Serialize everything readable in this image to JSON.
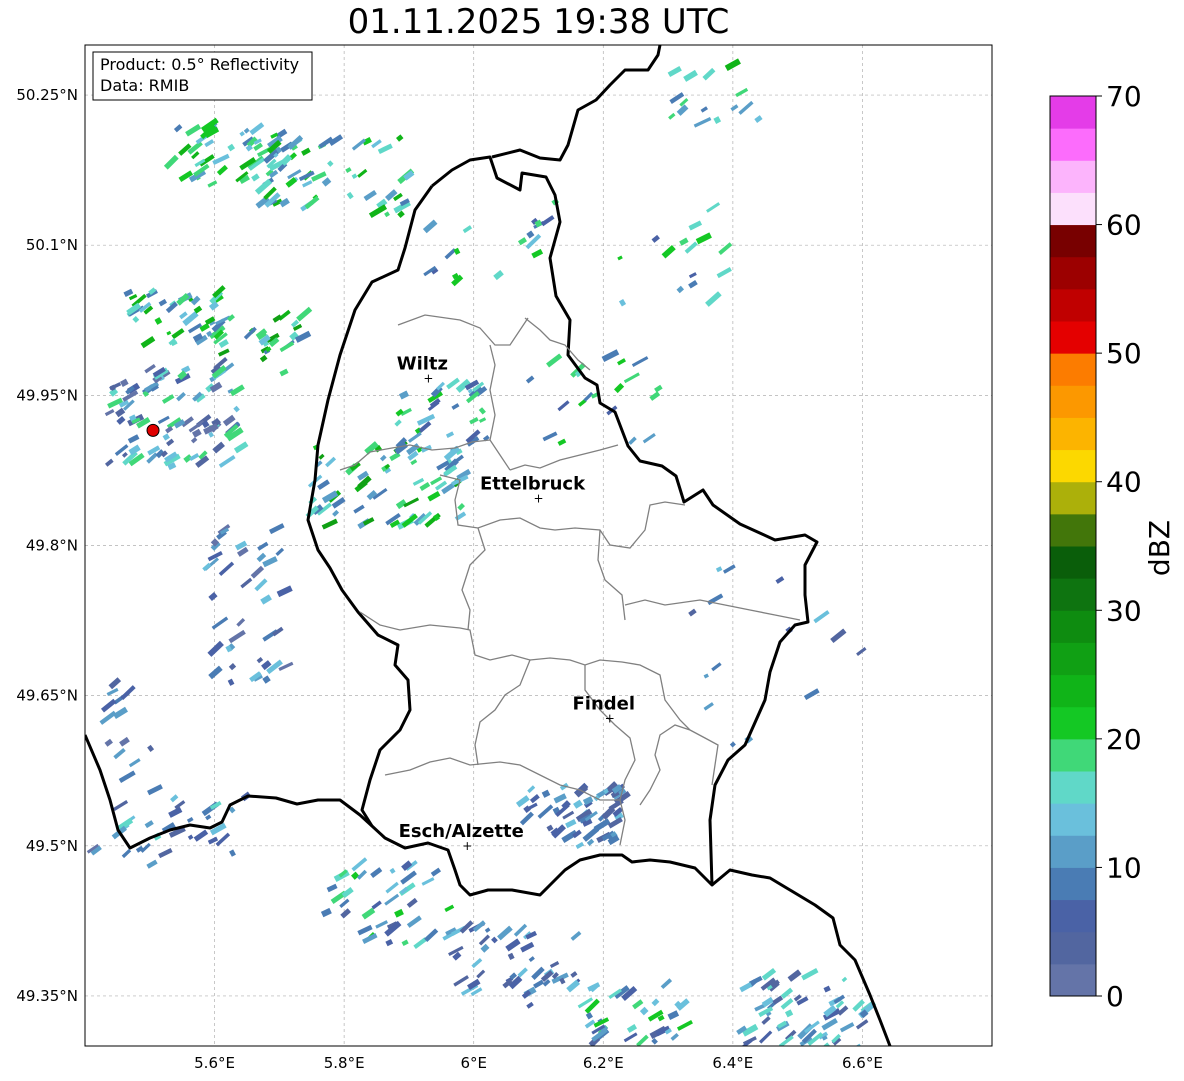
{
  "title": "01.11.2025 19:38 UTC",
  "info_box": {
    "line1": "Product: 0.5° Reflectivity",
    "line2": "Data: RMIB"
  },
  "map": {
    "lon_range": [
      5.4,
      6.8
    ],
    "lat_range": [
      49.3,
      50.3
    ],
    "gridlines": true,
    "lat_ticks": [
      {
        "value": 50.25,
        "label": "50.25°N"
      },
      {
        "value": 50.1,
        "label": "50.1°N"
      },
      {
        "value": 49.95,
        "label": "49.95°N"
      },
      {
        "value": 49.8,
        "label": "49.8°N"
      },
      {
        "value": 49.65,
        "label": "49.65°N"
      },
      {
        "value": 49.5,
        "label": "49.5°N"
      },
      {
        "value": 49.35,
        "label": "49.35°N"
      }
    ],
    "lon_ticks": [
      {
        "value": 5.6,
        "label": "5.6°E"
      },
      {
        "value": 5.8,
        "label": "5.8°E"
      },
      {
        "value": 6.0,
        "label": "6°E"
      },
      {
        "value": 6.2,
        "label": "6.2°E"
      },
      {
        "value": 6.4,
        "label": "6.4°E"
      },
      {
        "value": 6.6,
        "label": "6.6°E"
      }
    ],
    "cities": [
      {
        "name": "Wiltz",
        "lon": 5.93,
        "lat": 49.967
      },
      {
        "name": "Ettelbruck",
        "lon": 6.1,
        "lat": 49.847
      },
      {
        "name": "Findel",
        "lon": 6.21,
        "lat": 49.627
      },
      {
        "name": "Esch/Alzette",
        "lon": 5.99,
        "lat": 49.5
      }
    ],
    "radar_site": {
      "lon": 5.505,
      "lat": 49.915,
      "color": "#e00000"
    },
    "border_color": "#000000",
    "canton_color": "#808080"
  },
  "colorbar": {
    "label": "dBZ",
    "min": 0,
    "max": 70,
    "step": 2.5,
    "ticks": [
      {
        "value": 0,
        "label": "0"
      },
      {
        "value": 10,
        "label": "10"
      },
      {
        "value": 20,
        "label": "20"
      },
      {
        "value": 30,
        "label": "30"
      },
      {
        "value": 40,
        "label": "40"
      },
      {
        "value": 50,
        "label": "50"
      },
      {
        "value": 60,
        "label": "60"
      },
      {
        "value": 70,
        "label": "70"
      }
    ],
    "colors": [
      "#6474a8",
      "#5266a0",
      "#4a62a6",
      "#4a7cb4",
      "#5a9ec8",
      "#6ac0dc",
      "#60d8c8",
      "#40d878",
      "#14c824",
      "#10b418",
      "#10a014",
      "#0e8c10",
      "#0e7410",
      "#0a5e0a",
      "#42760a",
      "#acb00a",
      "#fcd800",
      "#fcb400",
      "#fc9800",
      "#fc7c00",
      "#e40000",
      "#c00000",
      "#9c0000",
      "#780000",
      "#fce0fc",
      "#fcb4fc",
      "#fc6cfc",
      "#e43ce8"
    ]
  },
  "echo_clusters": [
    {
      "lon": 5.62,
      "lat": 50.19,
      "spread_lon": 0.1,
      "spread_lat": 0.03,
      "count": 55,
      "intensity": [
        3,
        9
      ]
    },
    {
      "lon": 5.78,
      "lat": 50.17,
      "spread_lon": 0.12,
      "spread_lat": 0.04,
      "count": 45,
      "intensity": [
        3,
        9
      ]
    },
    {
      "lon": 5.53,
      "lat": 50.03,
      "spread_lon": 0.08,
      "spread_lat": 0.03,
      "count": 40,
      "intensity": [
        3,
        9
      ]
    },
    {
      "lon": 5.66,
      "lat": 50.0,
      "spread_lon": 0.07,
      "spread_lat": 0.03,
      "count": 30,
      "intensity": [
        3,
        10
      ]
    },
    {
      "lon": 5.53,
      "lat": 49.93,
      "spread_lon": 0.1,
      "spread_lat": 0.05,
      "count": 90,
      "intensity": [
        0,
        7
      ]
    },
    {
      "lon": 5.86,
      "lat": 49.86,
      "spread_lon": 0.12,
      "spread_lat": 0.04,
      "count": 70,
      "intensity": [
        3,
        10
      ]
    },
    {
      "lon": 5.95,
      "lat": 49.93,
      "spread_lon": 0.08,
      "spread_lat": 0.03,
      "count": 30,
      "intensity": [
        2,
        8
      ]
    },
    {
      "lon": 5.64,
      "lat": 49.74,
      "spread_lon": 0.06,
      "spread_lat": 0.08,
      "count": 40,
      "intensity": [
        0,
        5
      ]
    },
    {
      "lon": 6.14,
      "lat": 49.53,
      "spread_lon": 0.08,
      "spread_lat": 0.03,
      "count": 55,
      "intensity": [
        1,
        5
      ]
    },
    {
      "lon": 5.86,
      "lat": 49.44,
      "spread_lon": 0.1,
      "spread_lat": 0.04,
      "count": 40,
      "intensity": [
        1,
        8
      ]
    },
    {
      "lon": 6.06,
      "lat": 49.38,
      "spread_lon": 0.1,
      "spread_lat": 0.04,
      "count": 45,
      "intensity": [
        1,
        5
      ]
    },
    {
      "lon": 6.24,
      "lat": 49.33,
      "spread_lon": 0.08,
      "spread_lat": 0.03,
      "count": 35,
      "intensity": [
        1,
        8
      ]
    },
    {
      "lon": 6.5,
      "lat": 49.33,
      "spread_lon": 0.1,
      "spread_lat": 0.04,
      "count": 60,
      "intensity": [
        1,
        6
      ]
    },
    {
      "lon": 6.37,
      "lat": 50.25,
      "spread_lon": 0.08,
      "spread_lat": 0.03,
      "count": 15,
      "intensity": [
        3,
        9
      ]
    },
    {
      "lon": 6.3,
      "lat": 50.09,
      "spread_lon": 0.08,
      "spread_lat": 0.05,
      "count": 15,
      "intensity": [
        2,
        8
      ]
    },
    {
      "lon": 6.18,
      "lat": 49.95,
      "spread_lon": 0.1,
      "spread_lat": 0.05,
      "count": 20,
      "intensity": [
        2,
        8
      ]
    },
    {
      "lon": 6.02,
      "lat": 50.1,
      "spread_lon": 0.1,
      "spread_lat": 0.05,
      "count": 18,
      "intensity": [
        2,
        8
      ]
    },
    {
      "lon": 5.55,
      "lat": 49.52,
      "spread_lon": 0.1,
      "spread_lat": 0.03,
      "count": 25,
      "intensity": [
        1,
        6
      ]
    },
    {
      "lon": 6.45,
      "lat": 49.68,
      "spread_lon": 0.15,
      "spread_lat": 0.1,
      "count": 15,
      "intensity": [
        1,
        5
      ]
    },
    {
      "lon": 5.45,
      "lat": 49.58,
      "spread_lon": 0.05,
      "spread_lat": 0.1,
      "count": 20,
      "intensity": [
        0,
        4
      ]
    }
  ]
}
